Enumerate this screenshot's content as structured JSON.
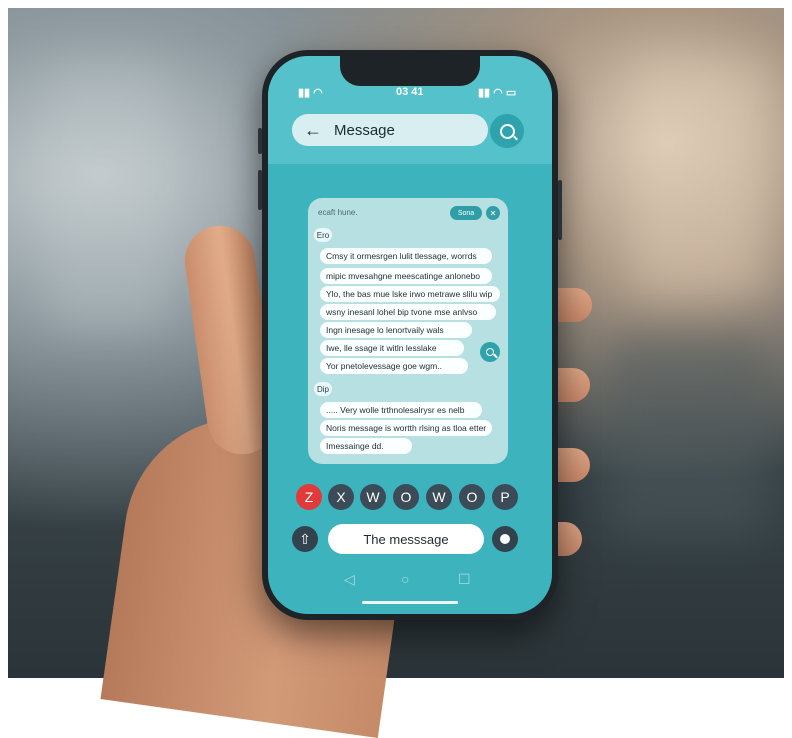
{
  "status_bar": {
    "time": "03 41"
  },
  "header": {
    "search_label": "Message",
    "back_icon": "arrow-left-icon",
    "search_icon": "search-icon"
  },
  "card": {
    "hint": "ecaft hune.",
    "chip_label": "Sona",
    "group1_tag": "Ero",
    "group1_messages": [
      "Cmsy it ormesrgen lulit tlessage, worrds",
      "mipic mvesahgne meescatinge anlonebo",
      "Ylo, the bas mue lske irwo metrawe slilu wip",
      "wsny inesanl lohel bip tvone mse anlvso",
      "Ingn inesage lo lenortvaily wals",
      "Iwe, lle ssage it witln lesslake",
      "Yor pnetolevessage goe wgm.."
    ],
    "group2_tag": "Dip",
    "group2_messages": [
      "..... Very wolle trthnolesalrysr es nelb",
      "Noris message is wortth rlsing as tloa etter",
      "Imessainge dd."
    ]
  },
  "keyboard": {
    "keys": [
      "Z",
      "X",
      "W",
      "O",
      "W",
      "O",
      "P"
    ],
    "highlight_color": "#e23a3a"
  },
  "composer": {
    "input_text": "The messsage"
  },
  "nav": {
    "back": "◁",
    "home": "○",
    "recent": "☐"
  },
  "colors": {
    "accent": "#2fa3ad",
    "screen": "#3cb3bd"
  }
}
